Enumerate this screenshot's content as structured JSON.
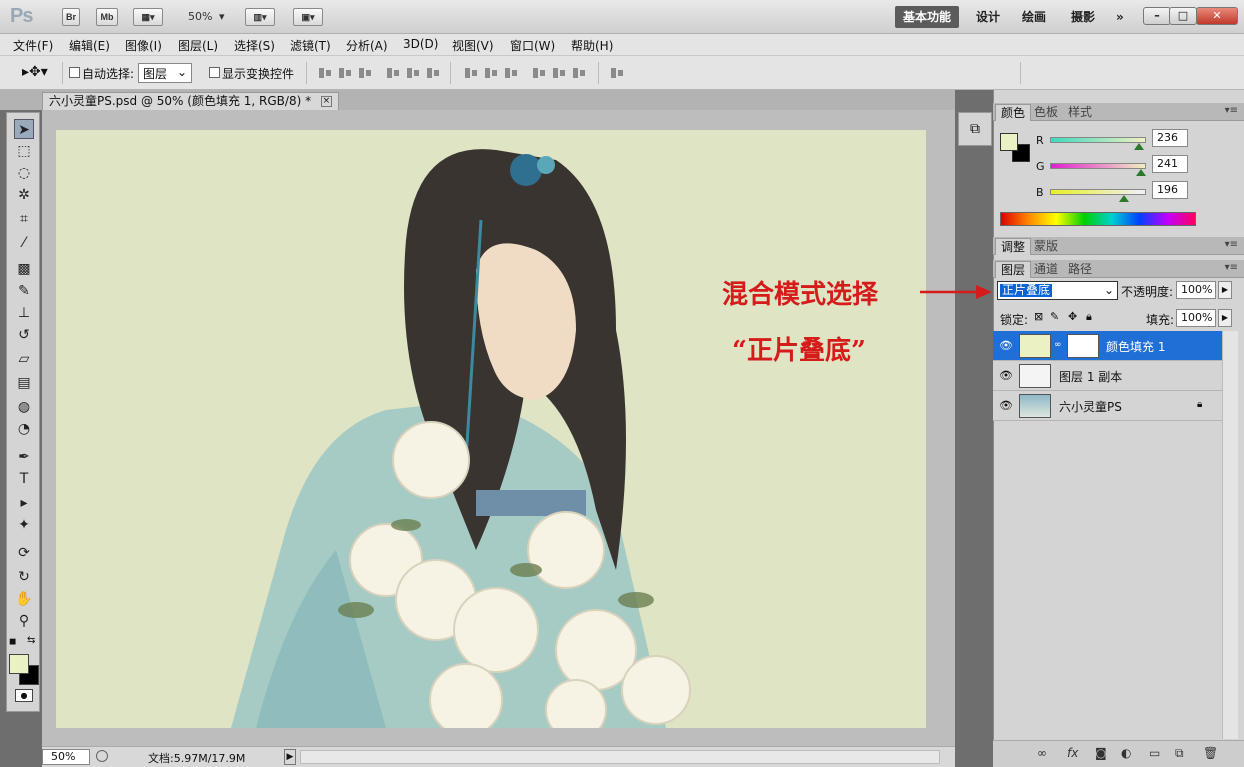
{
  "app": {
    "logo": "Ps"
  },
  "titlebar": {
    "bridge_label": "Br",
    "minibridge_label": "Mb",
    "zoom": "50%",
    "workspaces": [
      "基本功能",
      "设计",
      "绘画",
      "摄影"
    ],
    "more": "»"
  },
  "menu": [
    "文件(F)",
    "编辑(E)",
    "图像(I)",
    "图层(L)",
    "选择(S)",
    "滤镜(T)",
    "分析(A)",
    "3D(D)",
    "视图(V)",
    "窗口(W)",
    "帮助(H)"
  ],
  "options": {
    "auto_select_label": "自动选择:",
    "auto_select_value": "图层",
    "show_transform_label": "显示变换控件"
  },
  "document": {
    "tab_title": "六小灵童PS.psd @ 50% (颜色填充 1, RGB/8) *",
    "close_glyph": "×"
  },
  "status": {
    "zoom": "50%",
    "doc_info": "文档:5.97M/17.9M"
  },
  "color_panel": {
    "tabs": [
      "颜色",
      "色板",
      "样式"
    ],
    "fg_color": "#ecf1c4",
    "bg_color": "#000000",
    "channels": [
      {
        "label": "R",
        "value": "236",
        "fraction": 0.925
      },
      {
        "label": "G",
        "value": "241",
        "fraction": 0.945
      },
      {
        "label": "B",
        "value": "196",
        "fraction": 0.769
      }
    ]
  },
  "adjust_panel": {
    "tabs": [
      "调整",
      "蒙版"
    ]
  },
  "layers_panel": {
    "tabs": [
      "图层",
      "通道",
      "路径"
    ],
    "blend_mode": "正片叠底",
    "opacity_label": "不透明度:",
    "opacity": "100%",
    "lock_label": "锁定:",
    "fill_label": "填充:",
    "fill": "100%",
    "layers": [
      {
        "name": "颜色填充 1",
        "selected": true
      },
      {
        "name": "图层 1 副本",
        "selected": false
      },
      {
        "name": "六小灵童PS",
        "selected": false
      }
    ]
  },
  "annotation": {
    "line1": "混合模式选择",
    "line2": "“正片叠底”"
  },
  "colors": {
    "accent": "#1f6fd6",
    "annotation": "#d61b1b",
    "canvas_tint": "#dfe4c4"
  }
}
